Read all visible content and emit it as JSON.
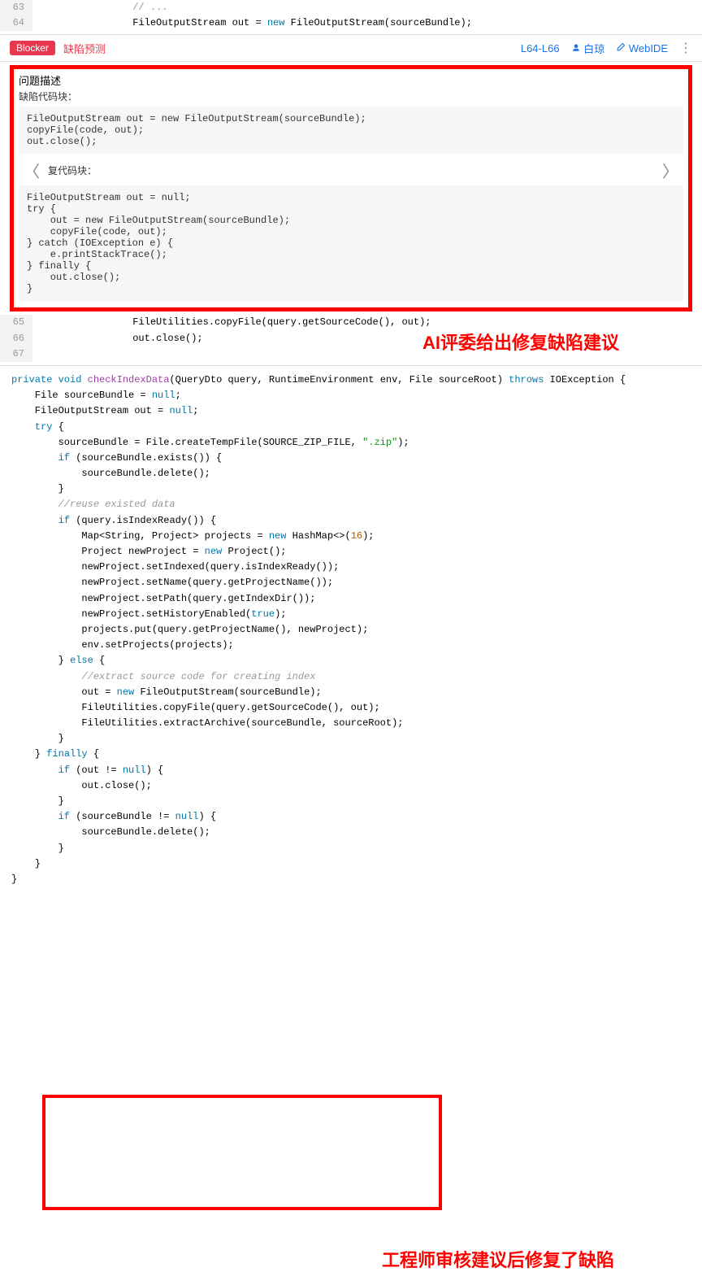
{
  "topCode": {
    "lines": [
      {
        "num": "63",
        "text": "                // ..."
      },
      {
        "num": "64",
        "text": "                FileOutputStream out = new FileOutputStream(sourceBundle);"
      }
    ]
  },
  "issueBar": {
    "blocker": "Blocker",
    "defectPrediction": "缺陷预测",
    "lineRange": "L64-L66",
    "author": "白琼",
    "webide": "WebIDE"
  },
  "issuePanel": {
    "title": "问题描述",
    "defectLabel": "缺陷代码块：",
    "defectCode": "FileOutputStream out = new FileOutputStream(sourceBundle);\ncopyFile(code, out);\nout.close();",
    "fixLabel": "复代码块：",
    "fixCode": "FileOutputStream out = null;\ntry {\n    out = new FileOutputStream(sourceBundle);\n    copyFile(code, out);\n} catch (IOException e) {\n    e.printStackTrace();\n} finally {\n    out.close();\n}"
  },
  "midCode": {
    "lines": [
      {
        "num": "65",
        "text": "                FileUtilities.copyFile(query.getSourceCode(), out);"
      },
      {
        "num": "66",
        "text": "                out.close();"
      },
      {
        "num": "67",
        "text": ""
      }
    ]
  },
  "annotation1": "AI评委给出修复缺陷建议",
  "annotation2": "工程师审核建议后修复了缺陷",
  "bottomCode": {
    "tokens": [
      [
        {
          "t": "private ",
          "c": "kw"
        },
        {
          "t": "void ",
          "c": "kw"
        },
        {
          "t": "checkIndexData",
          "c": "fn"
        },
        {
          "t": "(QueryDto query, RuntimeEnvironment env, File sourceRoot) "
        },
        {
          "t": "throws ",
          "c": "kw"
        },
        {
          "t": "IOException {"
        }
      ],
      [
        {
          "t": "    File sourceBundle = "
        },
        {
          "t": "null",
          "c": "kw"
        },
        {
          "t": ";"
        }
      ],
      [
        {
          "t": "    FileOutputStream out = "
        },
        {
          "t": "null",
          "c": "kw"
        },
        {
          "t": ";"
        }
      ],
      [
        {
          "t": ""
        }
      ],
      [
        {
          "t": "    try ",
          "c": "kw"
        },
        {
          "t": "{"
        }
      ],
      [
        {
          "t": "        sourceBundle = File.createTempFile(SOURCE_ZIP_FILE, "
        },
        {
          "t": "\".zip\"",
          "c": "str"
        },
        {
          "t": ");"
        }
      ],
      [
        {
          "t": "        if ",
          "c": "kw"
        },
        {
          "t": "(sourceBundle.exists()) {"
        }
      ],
      [
        {
          "t": "            sourceBundle.delete();"
        }
      ],
      [
        {
          "t": "        }"
        }
      ],
      [
        {
          "t": ""
        }
      ],
      [
        {
          "t": "        //reuse existed data",
          "c": "cm"
        }
      ],
      [
        {
          "t": "        if ",
          "c": "kw"
        },
        {
          "t": "(query.isIndexReady()) {"
        }
      ],
      [
        {
          "t": "            Map<String, Project> projects = "
        },
        {
          "t": "new ",
          "c": "kw"
        },
        {
          "t": "HashMap<>("
        },
        {
          "t": "16",
          "c": "num"
        },
        {
          "t": ");"
        }
      ],
      [
        {
          "t": "            Project newProject = "
        },
        {
          "t": "new ",
          "c": "kw"
        },
        {
          "t": "Project();"
        }
      ],
      [
        {
          "t": "            newProject.setIndexed(query.isIndexReady());"
        }
      ],
      [
        {
          "t": "            newProject.setName(query.getProjectName());"
        }
      ],
      [
        {
          "t": "            newProject.setPath(query.getIndexDir());"
        }
      ],
      [
        {
          "t": "            newProject.setHistoryEnabled("
        },
        {
          "t": "true",
          "c": "kw"
        },
        {
          "t": ");"
        }
      ],
      [
        {
          "t": "            projects.put(query.getProjectName(), newProject);"
        }
      ],
      [
        {
          "t": "            env.setProjects(projects);"
        }
      ],
      [
        {
          "t": "        } "
        },
        {
          "t": "else ",
          "c": "kw"
        },
        {
          "t": "{"
        }
      ],
      [
        {
          "t": "            //extract source code for creating index",
          "c": "cm"
        }
      ],
      [
        {
          "t": "            out = "
        },
        {
          "t": "new ",
          "c": "kw"
        },
        {
          "t": "FileOutputStream(sourceBundle);"
        }
      ],
      [
        {
          "t": "            FileUtilities.copyFile(query.getSourceCode(), out);"
        }
      ],
      [
        {
          "t": "            FileUtilities.extractArchive(sourceBundle, sourceRoot);"
        }
      ],
      [
        {
          "t": "        }"
        }
      ],
      [
        {
          "t": "    } "
        },
        {
          "t": "finally ",
          "c": "kw"
        },
        {
          "t": "{"
        }
      ],
      [
        {
          "t": "        if ",
          "c": "kw"
        },
        {
          "t": "(out != "
        },
        {
          "t": "null",
          "c": "kw"
        },
        {
          "t": ") {"
        }
      ],
      [
        {
          "t": "            out.close();"
        }
      ],
      [
        {
          "t": "        }"
        }
      ],
      [
        {
          "t": "        if ",
          "c": "kw"
        },
        {
          "t": "(sourceBundle != "
        },
        {
          "t": "null",
          "c": "kw"
        },
        {
          "t": ") {"
        }
      ],
      [
        {
          "t": "            sourceBundle.delete();"
        }
      ],
      [
        {
          "t": "        }"
        }
      ],
      [
        {
          "t": "    }"
        }
      ],
      [
        {
          "t": "}"
        }
      ]
    ]
  }
}
